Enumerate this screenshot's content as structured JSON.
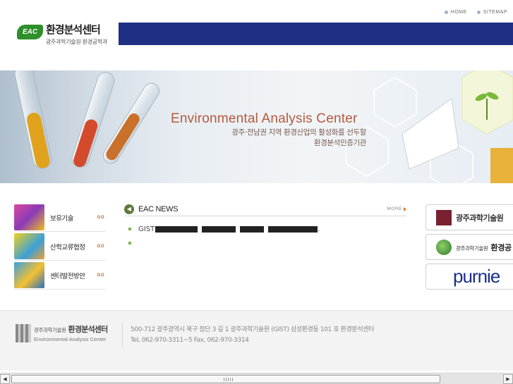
{
  "top_links": [
    {
      "label": "HOME"
    },
    {
      "label": "SITEMAP"
    }
  ],
  "logo": {
    "badge": "EAC",
    "title": "환경분석센터",
    "subtitle": "광주과학기술원 환경공학과"
  },
  "hero": {
    "title": "Environmental Analysis Center",
    "line1": "광주·전남권 지역 환경산업의 활성화를 선두할",
    "line2": "환경분석인증기관"
  },
  "quick_menu": {
    "go_label": "GO",
    "items": [
      {
        "label": "보유기술"
      },
      {
        "label": "산학교류협정"
      },
      {
        "label": "센터발전방안"
      }
    ]
  },
  "news": {
    "title": "EAC NEWS",
    "more_label": "MORE",
    "items": [
      {
        "prefix": "GIST",
        "suffix": "."
      },
      {
        "prefix": "",
        "suffix": ""
      }
    ]
  },
  "banners": {
    "gist": "광주과학기술원",
    "dept_small": "광주과학기술원",
    "dept_big": "환경공",
    "purnie": "purnie"
  },
  "footer": {
    "org_small": "광주과학기술원",
    "org_big": "환경분석센터",
    "org_en": "Environmental Analysis Center",
    "address": "500-712  광주광역시 북구 첨단 3 길 1 광주과학기술원 (GIST) 삼성환경동 101 호 환경분석센터",
    "contact": "Tel, 062-970-3311~5  Fax, 062-970-3314"
  },
  "colors": {
    "header_bar": "#1f2f83",
    "logo_green": "#2f8f2a",
    "hero_title": "#b55a3d",
    "go_orange": "#b86a2a"
  }
}
